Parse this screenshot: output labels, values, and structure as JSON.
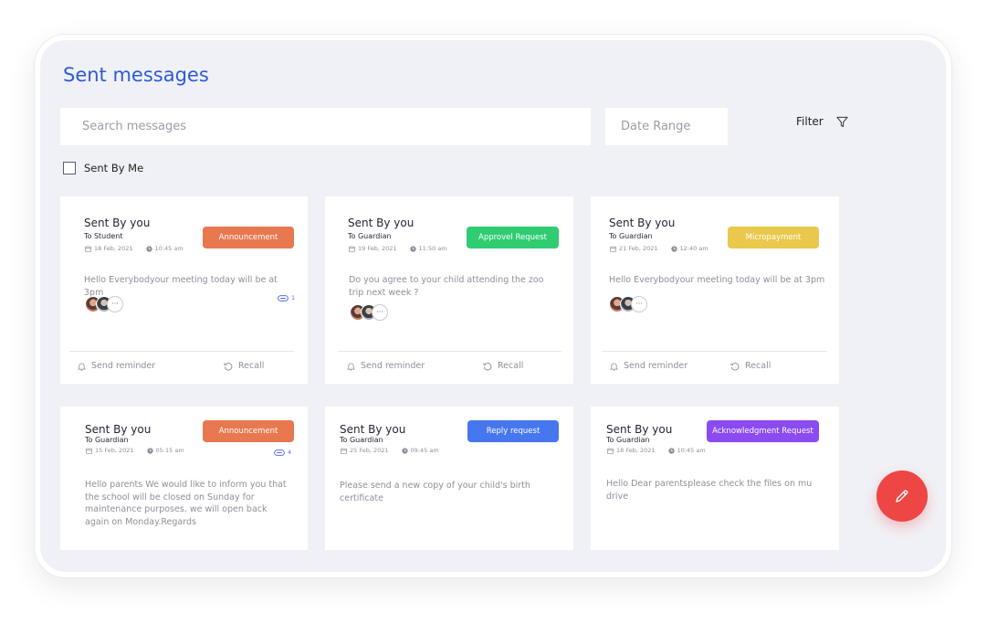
{
  "page": {
    "title": "Sent messages"
  },
  "search": {
    "placeholder": "Search messages"
  },
  "date_range": {
    "placeholder": "Date Range"
  },
  "filter": {
    "label": "Filter"
  },
  "sent_by_me": {
    "label": "Sent By Me",
    "checked": false
  },
  "actions": {
    "send_reminder": "Send reminder",
    "recall": "Recall"
  },
  "colors": {
    "accent": "#2f59d6",
    "announcement": "#e8784f",
    "approval": "#2fcc72",
    "micropayment": "#e9c84b",
    "reply": "#4677ee",
    "acknowledgment": "#8b4bf0",
    "fab": "#ee4545"
  },
  "messages": [
    {
      "sender": "Sent By you",
      "recipient": "To Student",
      "date": "18 Feb, 2021",
      "time": "10:45 am",
      "type": "Announcement",
      "body": "Hello Everybodyour meeting today will be at 3pm",
      "attachments": "1",
      "avatars": [
        "avatar",
        "avatar",
        "more"
      ]
    },
    {
      "sender": "Sent By you",
      "recipient": "To Guardian",
      "date": "19 Feb, 2021",
      "time": "11:50 am",
      "type": "Approvel Request",
      "body": "Do you agree to your child attending the zoo trip next week ?",
      "avatars": [
        "avatar",
        "avatar",
        "more"
      ]
    },
    {
      "sender": "Sent By you",
      "recipient": "To Guardian",
      "date": "21 Feb, 2021",
      "time": "12:40 am",
      "type": "Micropayment",
      "body": "Hello Everybodyour meeting today will be at 3pm",
      "avatars": [
        "avatar",
        "avatar",
        "more"
      ]
    },
    {
      "sender": "Sent By you",
      "recipient": "To Guardian",
      "date": "15 Feb, 2021",
      "time": "05:15 am",
      "type": "Announcement",
      "body": "Hello parents We would like to inform you that the school will be closed on Sunday for maintenance purposes. we will open back again on Monday.Regards",
      "attachments": "4"
    },
    {
      "sender": "Sent By you",
      "recipient": "To Guardian",
      "date": "25 Feb, 2021",
      "time": "09:45 am",
      "type": "Reply request",
      "body": "Please send a new copy of your child's birth certificate"
    },
    {
      "sender": "Sent By you",
      "recipient": "To Guardian",
      "date": "18 Feb, 2021",
      "time": "10:45 am",
      "type": "Acknowledgment Request",
      "body": "Hello Dear parentsplease check the files on mu drive"
    }
  ],
  "fab": {
    "icon": "pencil-icon"
  }
}
